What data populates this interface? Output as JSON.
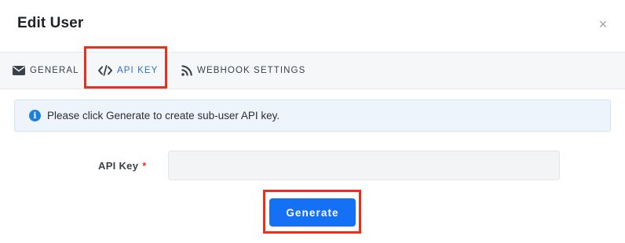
{
  "modal": {
    "title": "Edit User",
    "close_symbol": "×"
  },
  "tabs": [
    {
      "label": "GENERAL",
      "icon": "envelope-icon",
      "active": false
    },
    {
      "label": "API KEY",
      "icon": "code-icon",
      "active": true
    },
    {
      "label": "WEBHOOK SETTINGS",
      "icon": "rss-icon",
      "active": false
    }
  ],
  "alert": {
    "icon": "info-icon",
    "icon_glyph": "i",
    "text": "Please click Generate to create sub-user API key."
  },
  "form": {
    "api_key_label": "API Key",
    "required_marker": "*",
    "api_key_value": ""
  },
  "actions": {
    "generate_label": "Generate"
  },
  "colors": {
    "accent": "#1470f5",
    "active_tab": "#2f6fcf",
    "highlight": "#e8311a",
    "info": "#1d7fe0"
  }
}
